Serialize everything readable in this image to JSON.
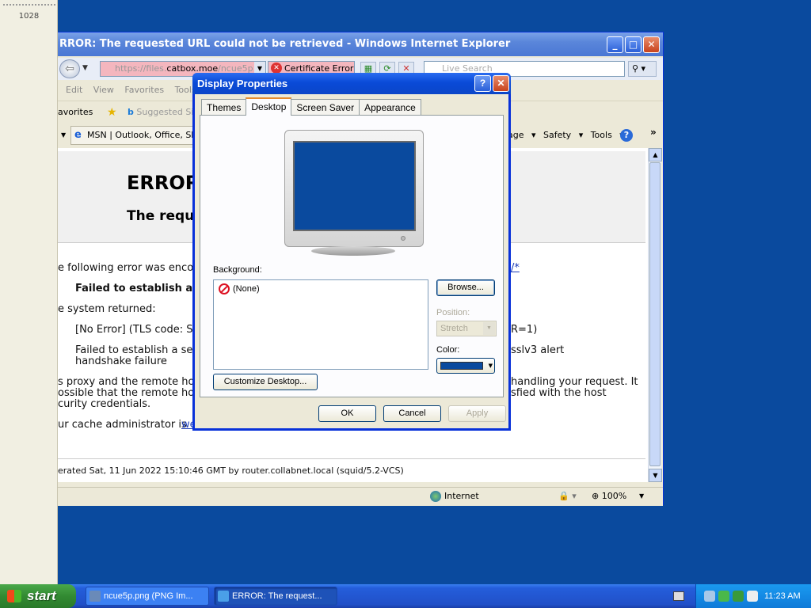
{
  "left_strip": {
    "number": "1028"
  },
  "ie": {
    "title": "RROR: The requested URL could not be retrieved - Windows Internet Explorer",
    "url_prefix": "https://files.",
    "url_host": "catbox.moe",
    "url_suffix": "/ncue5p.pn",
    "cert_error": "Certificate Error",
    "search_placeholder": "Live Search",
    "menu": "Edit  View  Favorites  Tools",
    "favorites_label": "avorites",
    "suggested_sites": "Suggested Si",
    "tab_label": "MSN | Outlook, Office, Skyp",
    "commands": "age ▾  Safety ▾  Tools ▾",
    "page": {
      "heading1": "ERROR",
      "heading2": "The requ",
      "line1": "e following error was encou",
      "line1_link": "/*",
      "line2": "Failed to establish a se",
      "line3": "e system returned:",
      "line4": "[No Error] (TLS code: SC",
      "line4_end": "R=1)",
      "line5a": "Failed to establish a se",
      "line5a_end": "sslv3 alert",
      "line5b": "handshake failure",
      "line6a": "s proxy and the remote ho",
      "line6a_end": "handling your request. It",
      "line6b": "ossible that the remote ho",
      "line6b_end": "sfied with the host",
      "line6c": "curity credentials.",
      "line7": "ur cache administrator is ",
      "line7_link": "we",
      "footer": "erated Sat, 11 Jun 2022 15:10:46 GMT by router.collabnet.local (squid/5.2-VCS)"
    },
    "status": {
      "zone": "Internet",
      "zoom": "100%"
    }
  },
  "dialog": {
    "title": "Display Properties",
    "tabs": [
      "Themes",
      "Desktop",
      "Screen Saver",
      "Appearance"
    ],
    "active_tab": "Desktop",
    "background_label": "Background:",
    "background_items": [
      "(None)"
    ],
    "browse_label": "Browse...",
    "position_label": "Position:",
    "position_value": "Stretch",
    "color_label": "Color:",
    "color_value": "#0a4a9e",
    "customize_label": "Customize Desktop...",
    "ok_label": "OK",
    "cancel_label": "Cancel",
    "apply_label": "Apply"
  },
  "taskbar": {
    "start_label": "start",
    "items": [
      {
        "label": "ncue5p.png (PNG Im..."
      },
      {
        "label": "ERROR: The request..."
      }
    ],
    "clock": "11:23 AM"
  }
}
